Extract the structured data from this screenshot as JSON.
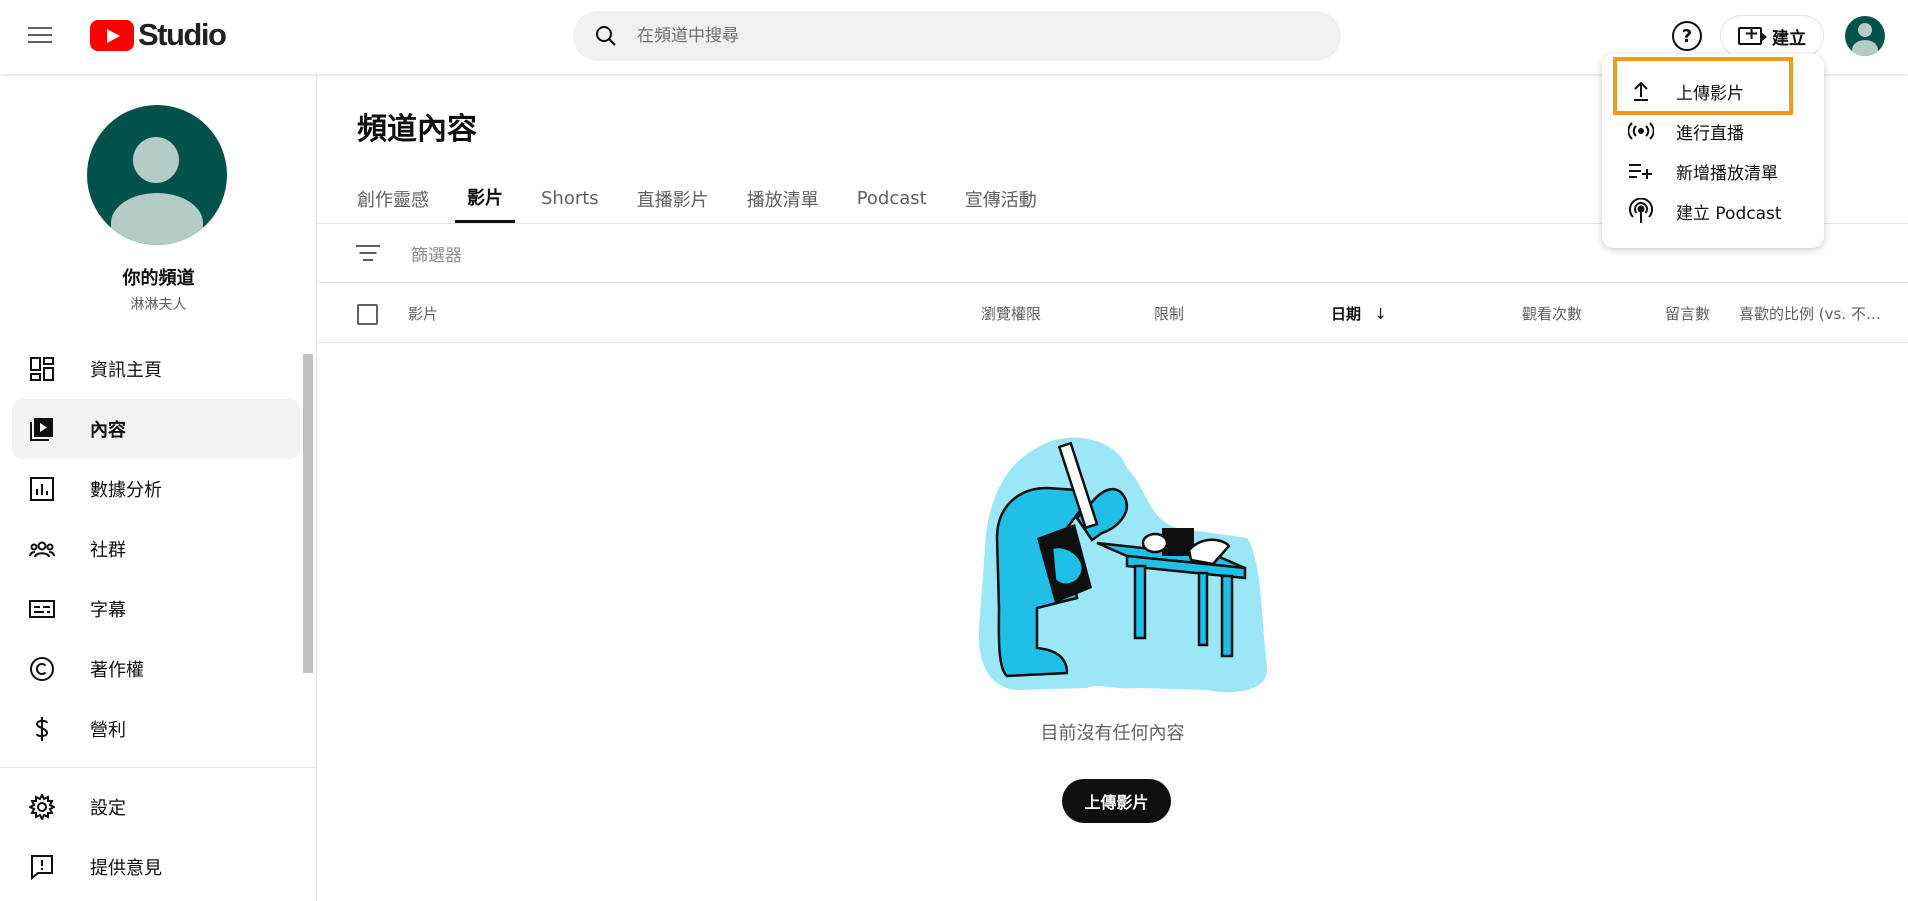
{
  "header": {
    "logo_text": "Studio",
    "search_placeholder": "在頻道中搜尋",
    "help_label": "?",
    "create_label": "建立"
  },
  "sidebar": {
    "channel_title": "你的頻道",
    "channel_sub": "淋淋夫人",
    "items": [
      {
        "label": "資訊主頁",
        "icon": "dashboard-icon"
      },
      {
        "label": "內容",
        "icon": "content-icon",
        "active": true
      },
      {
        "label": "數據分析",
        "icon": "analytics-icon"
      },
      {
        "label": "社群",
        "icon": "community-icon"
      },
      {
        "label": "字幕",
        "icon": "subtitles-icon"
      },
      {
        "label": "著作權",
        "icon": "copyright-icon"
      },
      {
        "label": "營利",
        "icon": "monetization-icon"
      }
    ],
    "bottom_items": [
      {
        "label": "設定",
        "icon": "settings-icon"
      },
      {
        "label": "提供意見",
        "icon": "feedback-icon"
      }
    ]
  },
  "main": {
    "title": "頻道內容",
    "tabs": [
      {
        "label": "創作靈感"
      },
      {
        "label": "影片",
        "active": true
      },
      {
        "label": "Shorts"
      },
      {
        "label": "直播影片"
      },
      {
        "label": "播放清單"
      },
      {
        "label": "Podcast"
      },
      {
        "label": "宣傳活動"
      }
    ],
    "filter_label": "篩選器",
    "columns": {
      "video": "影片",
      "visibility": "瀏覽權限",
      "restrictions": "限制",
      "date": "日期",
      "date_sort": "↓",
      "views": "觀看次數",
      "comments": "留言數",
      "likes": "喜歡的比例 (vs. 不…"
    },
    "empty_text": "目前沒有任何內容",
    "upload_button": "上傳影片"
  },
  "dropdown": {
    "items": [
      {
        "label": "上傳影片",
        "icon": "upload-icon",
        "highlighted": true
      },
      {
        "label": "進行直播",
        "icon": "live-icon"
      },
      {
        "label": "新增播放清單",
        "icon": "add-playlist-icon"
      },
      {
        "label": "建立 Podcast",
        "icon": "podcast-icon"
      }
    ]
  },
  "colors": {
    "brand_red": "#ff0000",
    "avatar_green": "#00524a",
    "highlight_orange": "#f29a1f",
    "illustration_cyan": "#1fbfe6"
  }
}
